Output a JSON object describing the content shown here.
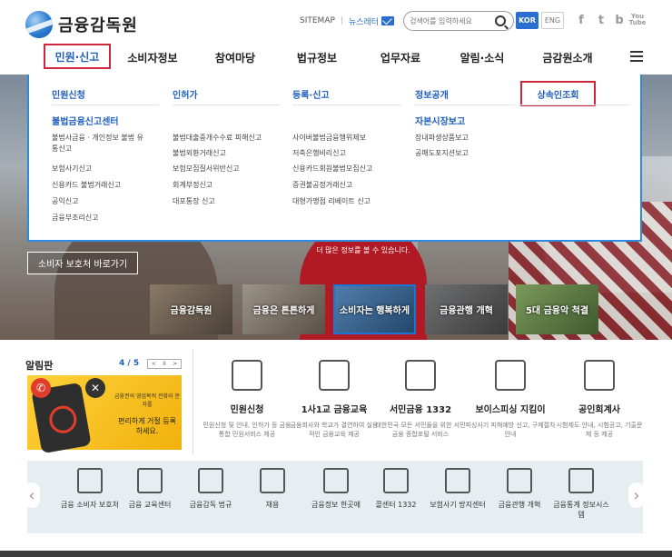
{
  "header": {
    "logo_text": "금융감독원",
    "sitemap": "SITEMAP",
    "newsletter": "뉴스레터",
    "search_placeholder": "검색어를 입력하세요",
    "lang_kor": "KOR",
    "lang_eng": "ENG",
    "sns": {
      "facebook": "f",
      "twitter": "t",
      "blog": "b",
      "youtube": "You Tube"
    }
  },
  "gnb": [
    "민원·신고",
    "소비자정보",
    "참여마당",
    "법규정보",
    "업무자료",
    "알림·소식",
    "금감원소개"
  ],
  "mega": {
    "columns": [
      "민원신청",
      "인허가",
      "등록·신고",
      "정보공개",
      "상속인조회"
    ],
    "sub1": "불법금융신고센터",
    "col1_items": [
      "불법사금융 · 개인정보 불법 유",
      "통신고",
      "보험사기신고",
      "신용카드 불법거래신고",
      "공익신고",
      "금융부조리신고"
    ],
    "col2_items": [
      "불법대출중개수수료 피해신고",
      "불법외환거래신고",
      "보험모집질서위반신고",
      "회계부정신고",
      "대포통장 신고"
    ],
    "col3_items": [
      "사이버불법금융행위제보",
      "저축은행비리신고",
      "신용카드회원불법모집신고",
      "증권불공정거래신고",
      "대형가맹점 리베이트 신고"
    ],
    "sub4": "자본시장보고",
    "col4_items": [
      "장내파생상품보고",
      "공매도포지션보고"
    ]
  },
  "hero": {
    "caption": "더 많은 정보를 볼 수 있습니다.",
    "shortcut": "소비자 보호처 바로가기",
    "tiles": [
      "금융감독원",
      "금융은 튼튼하게",
      "소비자는 행복하게",
      "금융관행 개혁",
      "5대 금융악 척결"
    ]
  },
  "notice": {
    "title": "알림판",
    "page": "4 / 5",
    "ctrl": [
      "<",
      "II",
      ">"
    ],
    "banner_small": "금융권의 영업목적 전화와 문자를",
    "banner_big": "편리하게 거절 등록 하세요."
  },
  "services": [
    {
      "title": "민원신청",
      "desc": "민원신청 및 안내, 인허가 등 금융통합 민원서비스 제공"
    },
    {
      "title": "1사1교 금융교육",
      "desc": "금융회사와 학교가 결연하여 실용적인 금융교육 제공"
    },
    {
      "title": "서민금융 1332",
      "desc": "대한민국 모든 서민들을 위한 서민금융 종합포털 서비스"
    },
    {
      "title": "보이스피싱 지킴이",
      "desc": "피싱사기 피해예방 신고, 구제절차 안내"
    },
    {
      "title": "공인회계사",
      "desc": "시험제도 안내, 시험공고, 기출문제 등 제공"
    }
  ],
  "quick": [
    "금융 소비자 보호처",
    "금융 교육센터",
    "금융감독 법규",
    "채용",
    "금융정보 한곳에",
    "콜센터 1332",
    "보험사기 방지센터",
    "금융관행 개혁",
    "금융통계 정보시스템"
  ],
  "colors": {
    "accent": "#2a6fd0",
    "highlight_box": "#d0263d",
    "quick_bg": "#e6eef2"
  }
}
